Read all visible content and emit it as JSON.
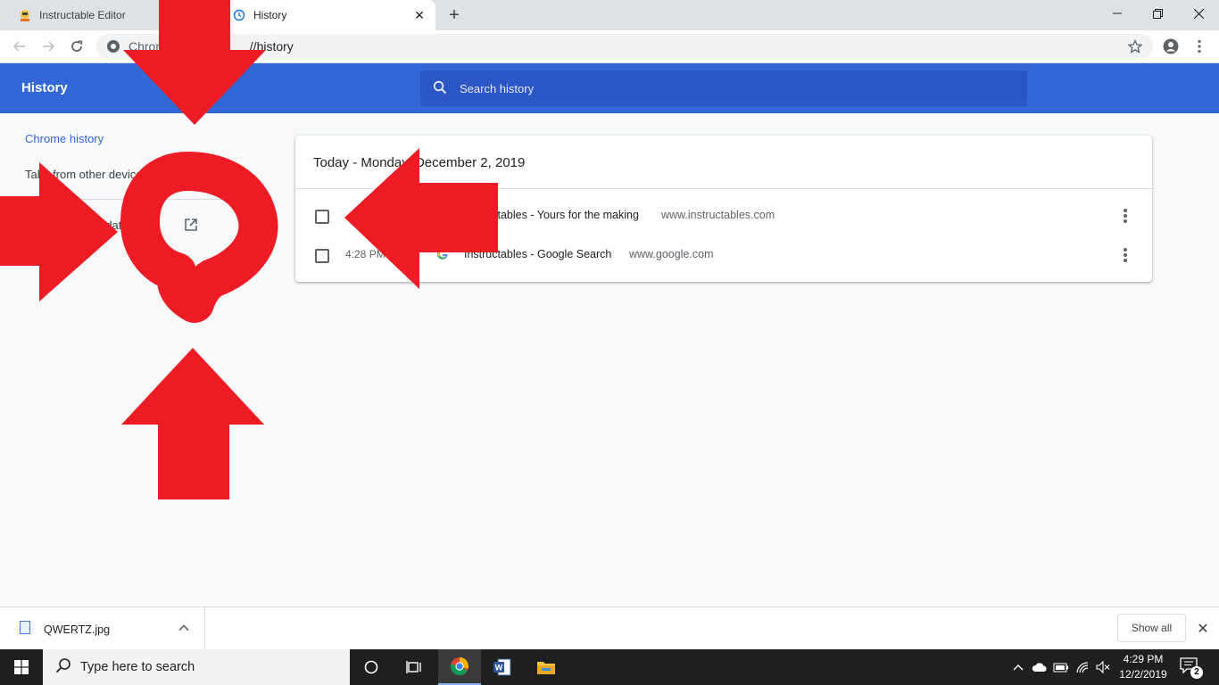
{
  "browser": {
    "tabs": [
      {
        "label": "Instructable Editor",
        "active": false
      },
      {
        "label": "History",
        "active": true
      }
    ],
    "omnibox": {
      "scheme": "Chrome",
      "path": "//history"
    },
    "colors": {
      "tabstrip": "#dee1e6",
      "accent": "#3367d6"
    }
  },
  "history": {
    "title": "History",
    "search_placeholder": "Search history",
    "sidebar": {
      "items": [
        {
          "label": "Chrome history",
          "selected": true
        },
        {
          "label": "Tabs from other devices",
          "selected": false
        },
        {
          "label": "Clear browsing data",
          "selected": false
        }
      ]
    },
    "day_heading": "Today - Monday, December 2, 2019",
    "entries": [
      {
        "time": "",
        "title": "Instructables - Yours for the making",
        "domain": "www.instructables.com",
        "favicon": "instructables-favicon"
      },
      {
        "time": "4:28 PM",
        "title": "Instructables - Google Search",
        "domain": "www.google.com",
        "favicon": "google-favicon"
      }
    ]
  },
  "downloads": {
    "file_name": "QWERTZ.jpg",
    "show_all_label": "Show all"
  },
  "taskbar": {
    "search_placeholder": "Type here to search",
    "clock_time": "4:29 PM",
    "clock_date": "12/2/2019",
    "notification_count": "2"
  }
}
